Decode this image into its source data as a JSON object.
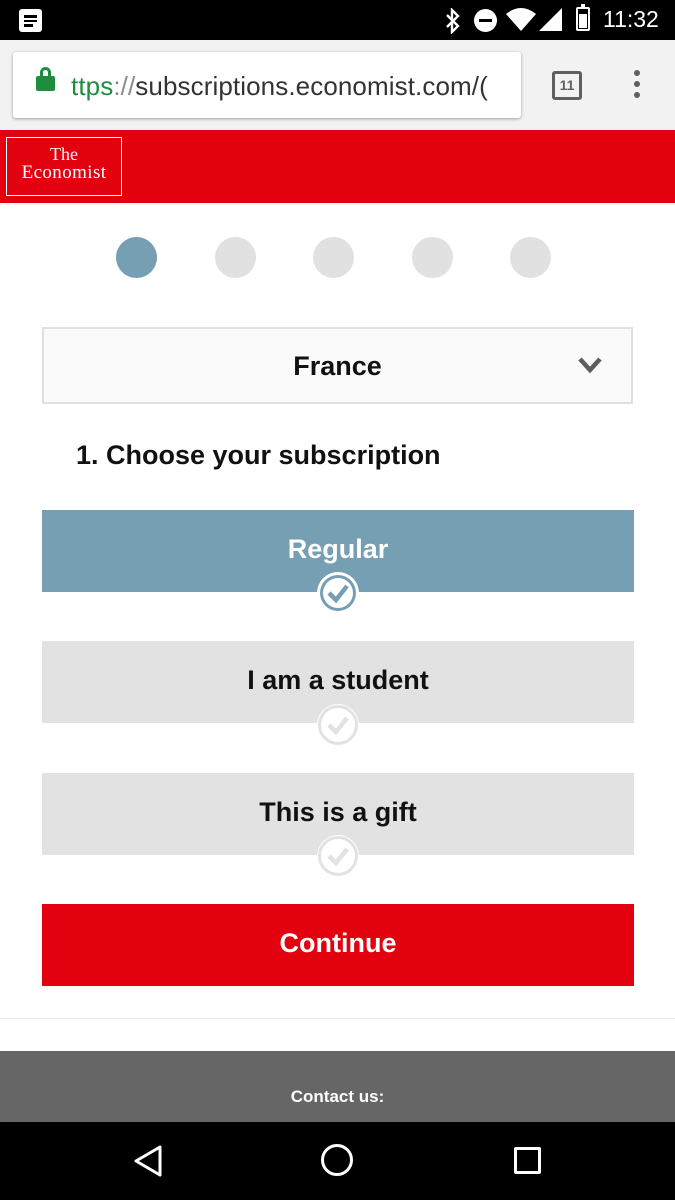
{
  "status_bar": {
    "time": "11:32",
    "icons": [
      "notification-icon",
      "bluetooth-icon",
      "do-not-disturb-icon",
      "wifi-icon",
      "signal-icon",
      "battery-icon"
    ]
  },
  "browser": {
    "url_scheme": "ttps",
    "url_separator": "://",
    "url_host": "subscriptions.economist.com/(",
    "tab_count": "11",
    "icons": [
      "lock-icon",
      "tab-switcher-icon",
      "overflow-menu-icon"
    ],
    "secure_color": "#1e8e3e"
  },
  "header": {
    "logo_line1": "The",
    "logo_line2": "Economist",
    "brand_color": "#e3000f"
  },
  "progress": {
    "total_steps": 5,
    "current_step": 1,
    "active_color": "#769fb4",
    "inactive_color": "#e1e1e1"
  },
  "country_select": {
    "value": "France",
    "icon": "chevron-down-icon"
  },
  "subscription": {
    "heading": "1. Choose your subscription",
    "options": [
      {
        "label": "Regular",
        "selected": true
      },
      {
        "label": "I am a student",
        "selected": false
      },
      {
        "label": "This is a gift",
        "selected": false
      }
    ],
    "continue_label": "Continue"
  },
  "footer": {
    "contact_label": "Contact us:"
  },
  "nav_bar": {
    "icons": [
      "back-icon",
      "home-icon",
      "recents-icon"
    ]
  }
}
